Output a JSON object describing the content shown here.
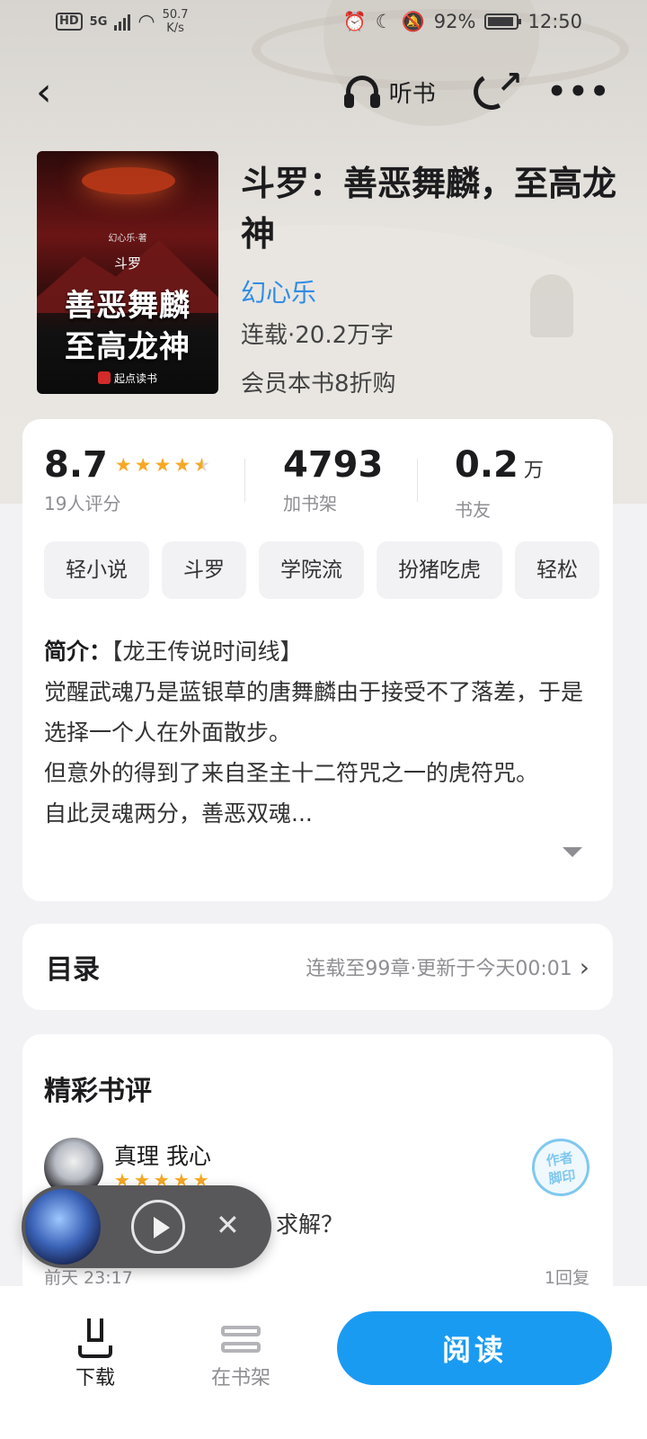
{
  "status_bar": {
    "hd": "HD",
    "signal": "5G",
    "speed_value": "50.7",
    "speed_unit": "K/s",
    "battery": "92%",
    "battery_level": 0.92,
    "time": "12:50"
  },
  "nav": {
    "listen_label": "听书"
  },
  "cover": {
    "author": "幻心乐·著",
    "small_title": "斗罗",
    "line1": "善恶舞麟",
    "line2": "至高龙神",
    "brand": "起点读书"
  },
  "book": {
    "title": "斗罗：善恶舞麟，至高龙神",
    "author": "幻心乐",
    "meta": "连载·20.2万字",
    "promo": "会员本书8折购"
  },
  "stats": {
    "rating": "8.7",
    "rating_stars": 4.5,
    "rating_label": "19人评分",
    "shelf_count": "4793",
    "shelf_label": "加书架",
    "friends": "0.2",
    "friends_unit": "万",
    "friends_label": "书友"
  },
  "tags": [
    "轻小说",
    "斗罗",
    "学院流",
    "扮猪吃虎",
    "轻松"
  ],
  "intro": {
    "lead": "简介：",
    "line1": "【龙王传说时间线】",
    "p1": "觉醒武魂乃是蓝银草的唐舞麟由于接受不了落差，于是选择一个人在外面散步。",
    "p2": "但意外的得到了来自圣主十二符咒之一的虎符咒。",
    "p3": "自此灵魂两分，善恶双魂..."
  },
  "toc": {
    "title": "目录",
    "meta": "连载至99章·更新于今天00:01"
  },
  "reviews": {
    "title": "精彩书评",
    "item": {
      "user": "真理  我心",
      "stars": 5,
      "badge_line1": "作者",
      "badge_line2": "脚印",
      "text_visible": "求解？",
      "date": "前天 23:17",
      "replies": "1回复"
    }
  },
  "bottom_bar": {
    "download_label": "下载",
    "shelf_label": "在书架",
    "read_label": "阅读"
  },
  "colors": {
    "accent": "#1a9bf2",
    "author_link": "#2e8de8",
    "star": "#f7a823"
  }
}
